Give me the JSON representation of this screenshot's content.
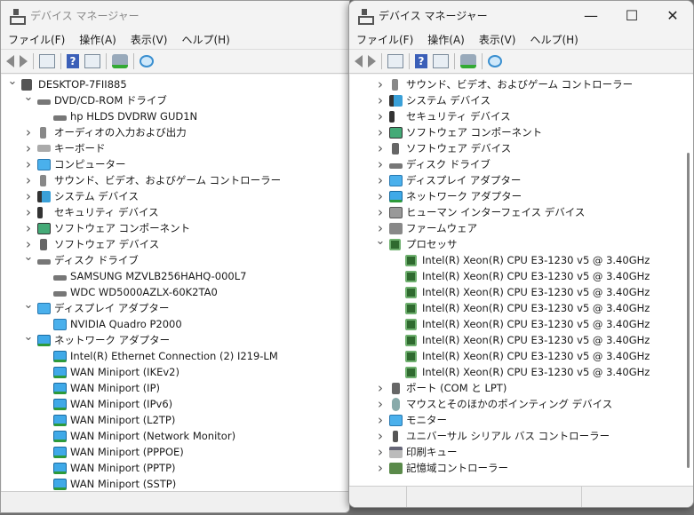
{
  "left": {
    "title": "デバイス マネージャー",
    "menu": [
      "ファイル(F)",
      "操作(A)",
      "表示(V)",
      "ヘルプ(H)"
    ],
    "rows": [
      {
        "level": 0,
        "exp": "v",
        "icon": "root",
        "text": "DESKTOP-7FII885"
      },
      {
        "level": 1,
        "exp": "v",
        "icon": "disk",
        "text": "DVD/CD-ROM ドライブ"
      },
      {
        "level": 2,
        "icon": "disk",
        "text": "hp HLDS DVDRW  GUD1N"
      },
      {
        "level": 1,
        "exp": ">",
        "icon": "sound",
        "text": "オーディオの入力および出力"
      },
      {
        "level": 1,
        "exp": ">",
        "icon": "kb",
        "text": "キーボード"
      },
      {
        "level": 1,
        "exp": ">",
        "icon": "mon",
        "text": "コンピューター"
      },
      {
        "level": 1,
        "exp": ">",
        "icon": "sound",
        "text": "サウンド、ビデオ、およびゲーム コントローラー"
      },
      {
        "level": 1,
        "exp": ">",
        "icon": "sys",
        "text": "システム デバイス"
      },
      {
        "level": 1,
        "exp": ">",
        "icon": "sec",
        "text": "セキュリティ デバイス"
      },
      {
        "level": 1,
        "exp": ">",
        "icon": "sw",
        "text": "ソフトウェア コンポーネント"
      },
      {
        "level": 1,
        "exp": ">",
        "icon": "gray",
        "text": "ソフトウェア デバイス"
      },
      {
        "level": 1,
        "exp": "v",
        "icon": "disk",
        "text": "ディスク ドライブ"
      },
      {
        "level": 2,
        "icon": "disk",
        "text": "SAMSUNG MZVLB256HAHQ-000L7"
      },
      {
        "level": 2,
        "icon": "disk",
        "text": "WDC WD5000AZLX-60K2TA0"
      },
      {
        "level": 1,
        "exp": "v",
        "icon": "mon",
        "text": "ディスプレイ アダプター"
      },
      {
        "level": 2,
        "icon": "mon",
        "text": "NVIDIA Quadro P2000"
      },
      {
        "level": 1,
        "exp": "v",
        "icon": "net",
        "text": "ネットワーク アダプター"
      },
      {
        "level": 2,
        "icon": "net",
        "text": "Intel(R) Ethernet Connection (2) I219-LM"
      },
      {
        "level": 2,
        "icon": "net",
        "text": "WAN Miniport (IKEv2)"
      },
      {
        "level": 2,
        "icon": "net",
        "text": "WAN Miniport (IP)"
      },
      {
        "level": 2,
        "icon": "net",
        "text": "WAN Miniport (IPv6)"
      },
      {
        "level": 2,
        "icon": "net",
        "text": "WAN Miniport (L2TP)"
      },
      {
        "level": 2,
        "icon": "net",
        "text": "WAN Miniport (Network Monitor)"
      },
      {
        "level": 2,
        "icon": "net",
        "text": "WAN Miniport (PPPOE)"
      },
      {
        "level": 2,
        "icon": "net",
        "text": "WAN Miniport (PPTP)"
      },
      {
        "level": 2,
        "icon": "net",
        "text": "WAN Miniport (SSTP)"
      }
    ]
  },
  "right": {
    "title": "デバイス マネージャー",
    "menu": [
      "ファイル(F)",
      "操作(A)",
      "表示(V)",
      "ヘルプ(H)"
    ],
    "controls": {
      "minimize": "—",
      "maximize": "☐",
      "close": "✕"
    },
    "rows": [
      {
        "level": 1,
        "exp": ">",
        "icon": "sound",
        "text": "サウンド、ビデオ、およびゲーム コントローラー"
      },
      {
        "level": 1,
        "exp": ">",
        "icon": "sys",
        "text": "システム デバイス"
      },
      {
        "level": 1,
        "exp": ">",
        "icon": "sec",
        "text": "セキュリティ デバイス"
      },
      {
        "level": 1,
        "exp": ">",
        "icon": "sw",
        "text": "ソフトウェア コンポーネント"
      },
      {
        "level": 1,
        "exp": ">",
        "icon": "gray",
        "text": "ソフトウェア デバイス"
      },
      {
        "level": 1,
        "exp": ">",
        "icon": "disk",
        "text": "ディスク ドライブ"
      },
      {
        "level": 1,
        "exp": ">",
        "icon": "mon",
        "text": "ディスプレイ アダプター"
      },
      {
        "level": 1,
        "exp": ">",
        "icon": "net",
        "text": "ネットワーク アダプター"
      },
      {
        "level": 1,
        "exp": ">",
        "icon": "hid",
        "text": "ヒューマン インターフェイス デバイス"
      },
      {
        "level": 1,
        "exp": ">",
        "icon": "fw",
        "text": "ファームウェア"
      },
      {
        "level": 1,
        "exp": "v",
        "icon": "cpu",
        "text": "プロセッサ"
      },
      {
        "level": 2,
        "icon": "cpu",
        "text": "Intel(R) Xeon(R) CPU E3-1230 v5 @ 3.40GHz"
      },
      {
        "level": 2,
        "icon": "cpu",
        "text": "Intel(R) Xeon(R) CPU E3-1230 v5 @ 3.40GHz"
      },
      {
        "level": 2,
        "icon": "cpu",
        "text": "Intel(R) Xeon(R) CPU E3-1230 v5 @ 3.40GHz"
      },
      {
        "level": 2,
        "icon": "cpu",
        "text": "Intel(R) Xeon(R) CPU E3-1230 v5 @ 3.40GHz"
      },
      {
        "level": 2,
        "icon": "cpu",
        "text": "Intel(R) Xeon(R) CPU E3-1230 v5 @ 3.40GHz"
      },
      {
        "level": 2,
        "icon": "cpu",
        "text": "Intel(R) Xeon(R) CPU E3-1230 v5 @ 3.40GHz"
      },
      {
        "level": 2,
        "icon": "cpu",
        "text": "Intel(R) Xeon(R) CPU E3-1230 v5 @ 3.40GHz"
      },
      {
        "level": 2,
        "icon": "cpu",
        "text": "Intel(R) Xeon(R) CPU E3-1230 v5 @ 3.40GHz"
      },
      {
        "level": 1,
        "exp": ">",
        "icon": "port",
        "text": "ポート (COM と LPT)"
      },
      {
        "level": 1,
        "exp": ">",
        "icon": "mouse",
        "text": "マウスとそのほかのポインティング デバイス"
      },
      {
        "level": 1,
        "exp": ">",
        "icon": "mon",
        "text": "モニター"
      },
      {
        "level": 1,
        "exp": ">",
        "icon": "usb",
        "text": "ユニバーサル シリアル バス コントローラー"
      },
      {
        "level": 1,
        "exp": ">",
        "icon": "print",
        "text": "印刷キュー"
      },
      {
        "level": 1,
        "exp": ">",
        "icon": "stor",
        "text": "記憶域コントローラー"
      }
    ]
  }
}
